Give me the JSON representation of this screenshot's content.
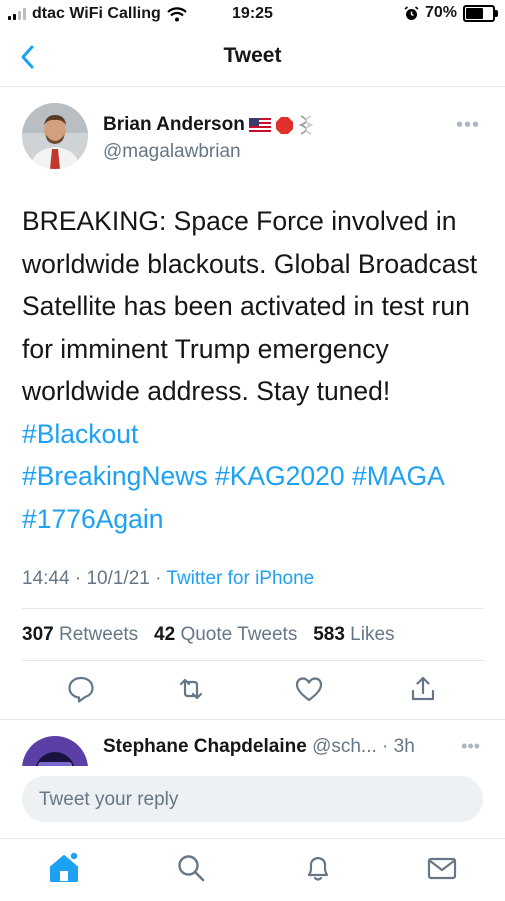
{
  "status_bar": {
    "carrier": "dtac WiFi Calling",
    "time": "19:25",
    "battery": "70%",
    "battery_level": 0.7
  },
  "nav": {
    "title": "Tweet"
  },
  "tweet": {
    "author_name": "Brian Anderson",
    "handle": "@magalawbrian",
    "text": "BREAKING: Space Force involved in worldwide blackouts. Global Broadcast Satellite has been activated in test run for imminent Trump emergency worldwide address. Stay tuned!",
    "hashtags": [
      "#Blackout",
      "#BreakingNews",
      "#KAG2020",
      "#MAGA",
      "#1776Again"
    ],
    "time": "14:44",
    "date": "10/1/21",
    "separator": "·",
    "source": "Twitter for iPhone",
    "retweets_count": "307",
    "retweets_label": "Retweets",
    "quotes_count": "42",
    "quotes_label": "Quote Tweets",
    "likes_count": "583",
    "likes_label": "Likes"
  },
  "reply_preview": {
    "name": "Stephane Chapdelaine",
    "handle": "@sch...",
    "age": "· 3h"
  },
  "reply_input": {
    "placeholder": "Tweet your reply"
  },
  "colors": {
    "accent": "#1da1f2",
    "secondary_text": "#657786",
    "divider": "#e1e8ed"
  },
  "icons": {
    "back": "chevron-left-icon",
    "reply": "comment-icon",
    "retweet": "retweet-icon",
    "like": "heart-icon",
    "share": "share-icon",
    "home": "home-icon",
    "search": "search-icon",
    "notifications": "bell-icon",
    "messages": "mail-icon"
  }
}
